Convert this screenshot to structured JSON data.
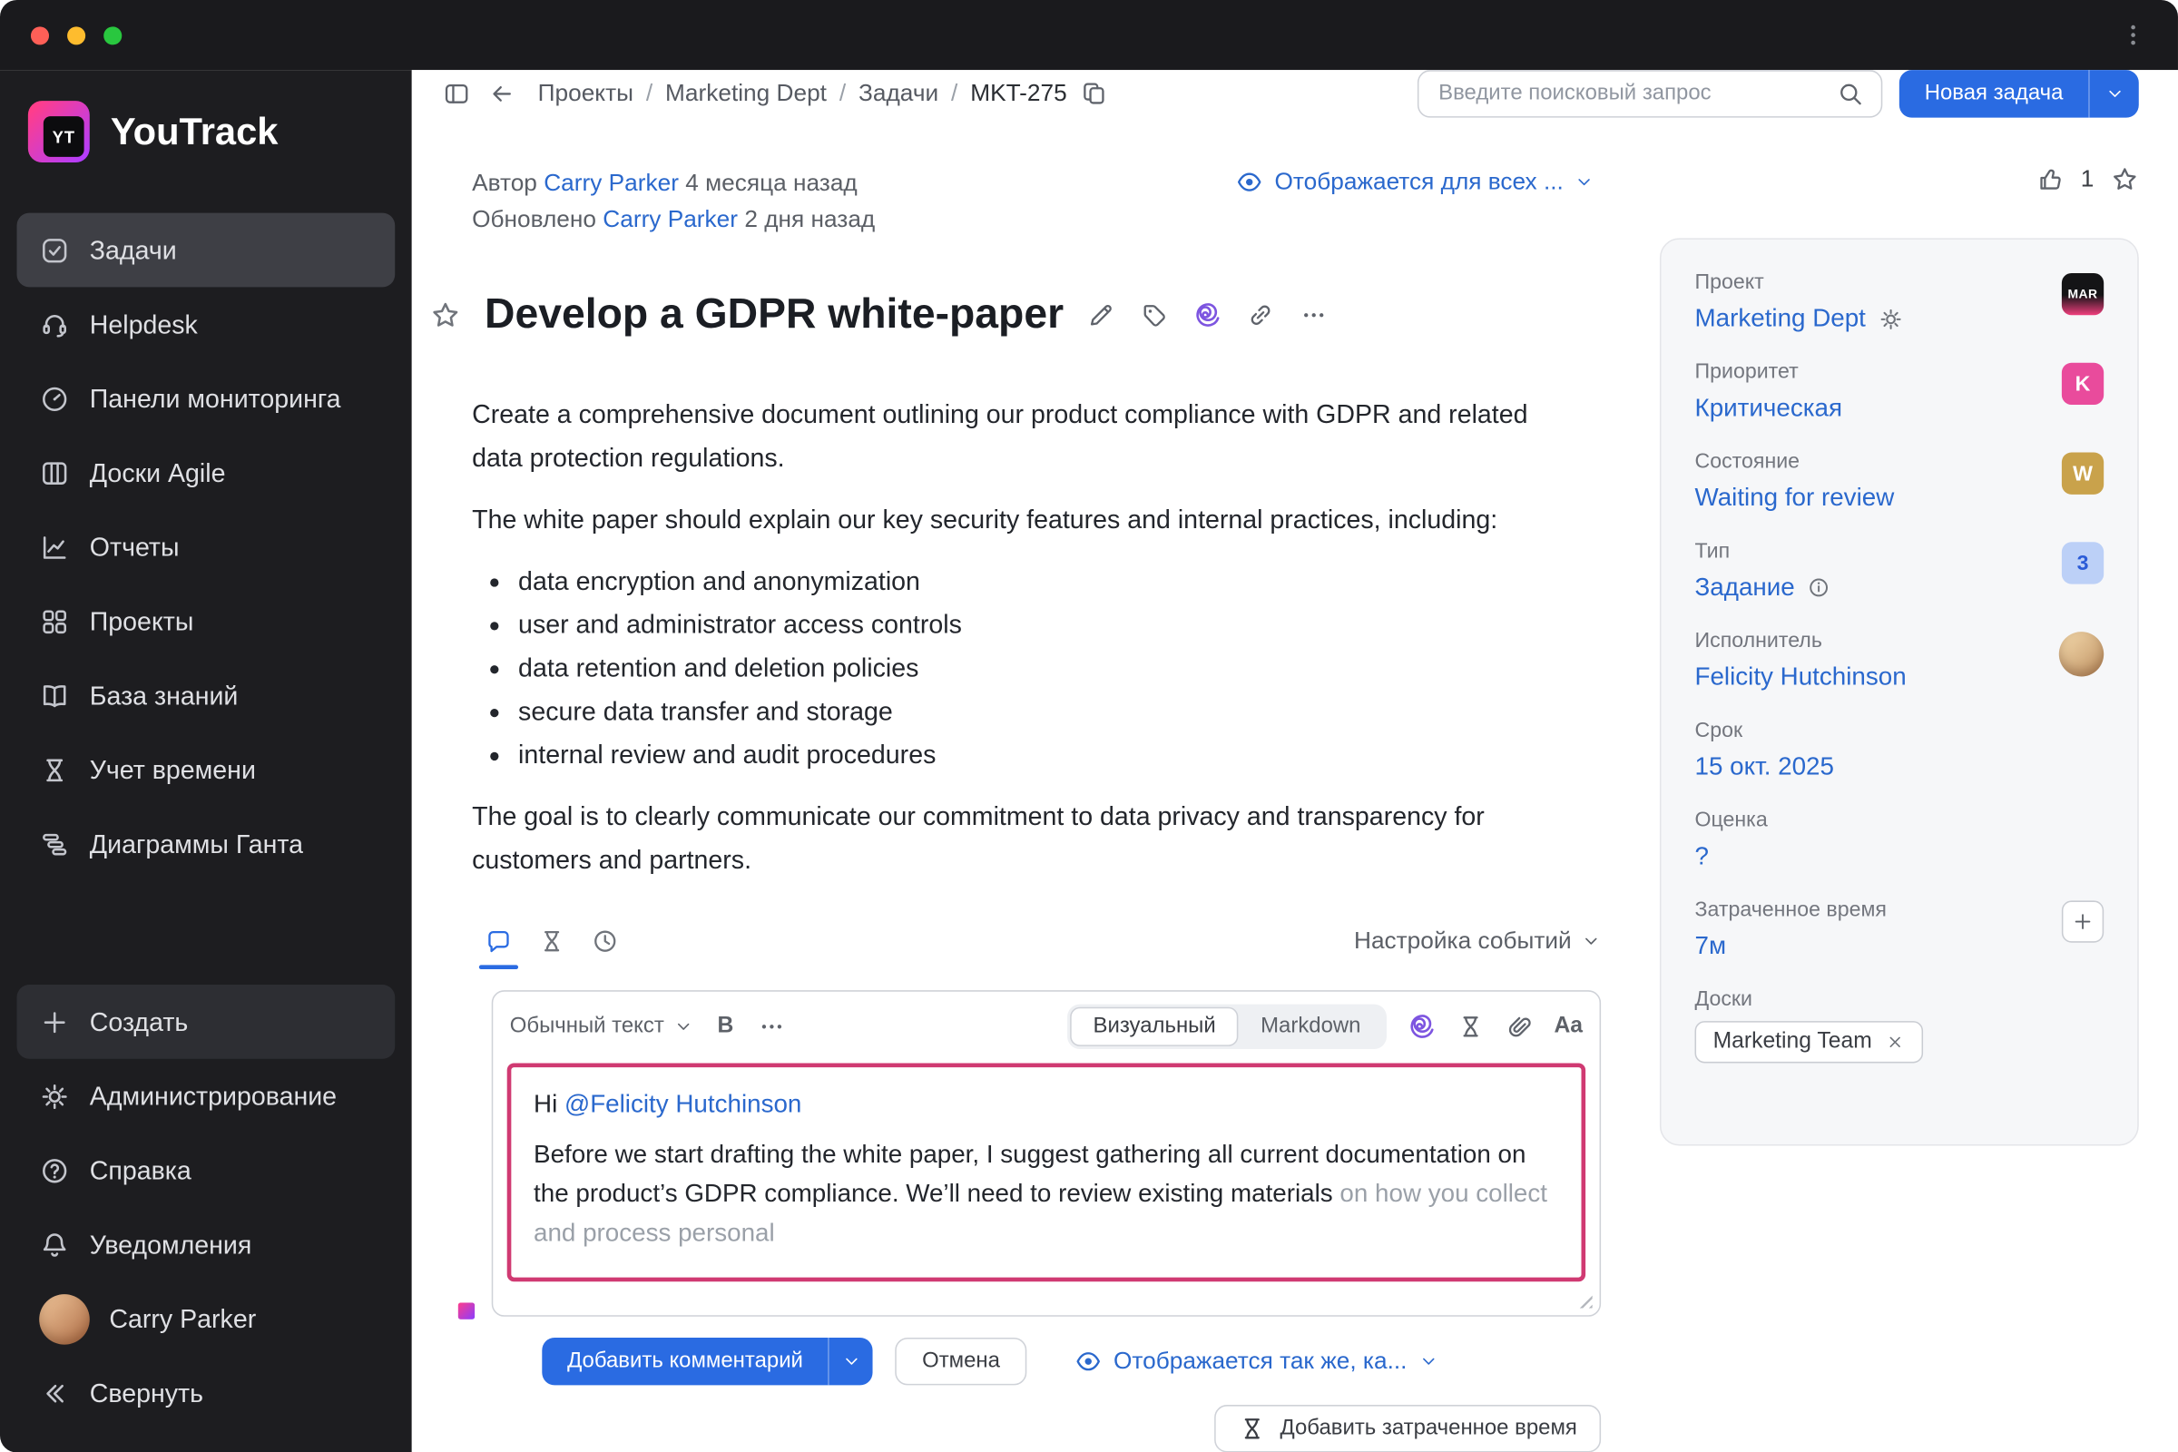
{
  "colors": {
    "accent_blue": "#2a6be2",
    "link_blue": "#2a68cd",
    "highlight_pink": "#d03a72",
    "sidebar_bg": "#1d1d20",
    "panel_bg": "#f6f7f9",
    "priority_badge": "#e94b9c",
    "state_badge": "#c9a24b",
    "type_badge_bg": "#bcd0f7",
    "type_badge_text": "#2a5bd7"
  },
  "app": {
    "name": "YouTrack",
    "logo_monogram": "YT"
  },
  "sidebar": {
    "items": [
      {
        "label": "Задачи",
        "icon": "tasks-icon",
        "selected": true
      },
      {
        "label": "Helpdesk",
        "icon": "helpdesk-icon",
        "selected": false
      },
      {
        "label": "Панели мониторинга",
        "icon": "dashboards-icon",
        "selected": false
      },
      {
        "label": "Доски Agile",
        "icon": "agile-boards-icon",
        "selected": false
      },
      {
        "label": "Отчеты",
        "icon": "reports-icon",
        "selected": false
      },
      {
        "label": "Проекты",
        "icon": "projects-icon",
        "selected": false
      },
      {
        "label": "База знаний",
        "icon": "knowledge-base-icon",
        "selected": false
      },
      {
        "label": "Учет времени",
        "icon": "time-tracking-icon",
        "selected": false
      },
      {
        "label": "Диаграммы Ганта",
        "icon": "gantt-icon",
        "selected": false
      }
    ],
    "footer_items": [
      {
        "label": "Создать",
        "icon": "plus-icon"
      },
      {
        "label": "Администрирование",
        "icon": "gear-icon"
      },
      {
        "label": "Справка",
        "icon": "help-icon"
      },
      {
        "label": "Уведомления",
        "icon": "bell-icon"
      },
      {
        "label": "Carry Parker",
        "icon": "user-avatar"
      },
      {
        "label": "Свернуть",
        "icon": "collapse-icon"
      }
    ]
  },
  "topbar": {
    "breadcrumb": [
      {
        "label": "Проекты"
      },
      {
        "label": "Marketing Dept"
      },
      {
        "label": "Задачи"
      },
      {
        "label": "MKT-275"
      }
    ],
    "search_placeholder": "Введите поисковый запрос",
    "new_task_label": "Новая задача"
  },
  "issue": {
    "author_label": "Автор",
    "author_name": "Carry Parker",
    "created_ago": "4 месяца назад",
    "updated_label": "Обновлено",
    "updater_name": "Carry Parker",
    "updated_ago": "2 дня назад",
    "visibility_label": "Отображается для всех ...",
    "likes_count": "1",
    "title": "Develop a GDPR white-paper",
    "description_p1": "Create a comprehensive document outlining our product compliance with GDPR and related data protection regulations.",
    "description_p2": "The white paper should explain our key security features and internal practices, including:",
    "bullets": [
      "data encryption and anonymization",
      "user and administrator access controls",
      "data retention and deletion policies",
      "secure data transfer and storage",
      "internal review and audit procedures"
    ],
    "description_p3": "The goal is to clearly communicate our commitment to data privacy and transparency for customers and partners."
  },
  "activity": {
    "events_settings_label": "Настройка событий",
    "composer": {
      "format_label": "Обычный текст",
      "bold_label": "B",
      "mode_visual": "Визуальный",
      "mode_markdown": "Markdown",
      "text_style_label": "Aa",
      "greeting": "Hi",
      "mention": "@Felicity Hutchinson",
      "body": "Before we start drafting the white paper, I suggest gathering all current documentation on the product’s GDPR compliance. We’ll need to review existing materials",
      "ai_suggestion": "on how you collect and process personal",
      "add_comment_label": "Добавить комментарий",
      "cancel_label": "Отмена",
      "visibility_label": "Отображается так же, ка...",
      "add_spent_time_label": "Добавить затраченное время"
    }
  },
  "panel": {
    "fields": [
      {
        "label": "Проект",
        "value": "Marketing Dept",
        "badge": "MAR"
      },
      {
        "label": "Приоритет",
        "value": "Критическая",
        "badge": "K"
      },
      {
        "label": "Состояние",
        "value": "Waiting for review",
        "badge": "W"
      },
      {
        "label": "Тип",
        "value": "Задание",
        "badge": "3"
      },
      {
        "label": "Исполнитель",
        "value": "Felicity Hutchinson"
      },
      {
        "label": "Срок",
        "value": "15 окт. 2025"
      },
      {
        "label": "Оценка",
        "value": "?"
      },
      {
        "label": "Затраченное время",
        "value": "7м"
      },
      {
        "label": "Доски",
        "tag": "Marketing Team"
      }
    ]
  }
}
